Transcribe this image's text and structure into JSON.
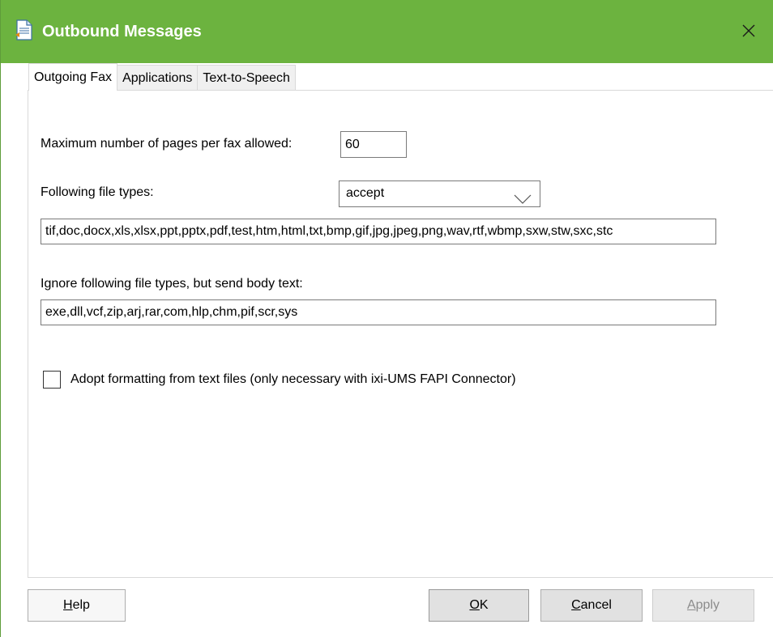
{
  "window": {
    "title": "Outbound Messages",
    "title_bar_color": "#6cb33f"
  },
  "tabs": [
    {
      "label": "Outgoing Fax",
      "active": true
    },
    {
      "label": "Applications",
      "active": false
    },
    {
      "label": "Text-to-Speech",
      "active": false
    }
  ],
  "fax": {
    "max_pages_label": "Maximum number of pages per fax allowed:",
    "max_pages_value": "60",
    "file_types_label": "Following file types:",
    "file_types_mode": "accept",
    "file_types_value": "tif,doc,docx,xls,xlsx,ppt,pptx,pdf,test,htm,html,txt,bmp,gif,jpg,jpeg,png,wav,rtf,wbmp,sxw,stw,sxc,stc",
    "ignore_label": "Ignore following file types, but send body text:",
    "ignore_value": "exe,dll,vcf,zip,arj,rar,com,hlp,chm,pif,scr,sys",
    "adopt_formatting_label": "Adopt formatting from text files (only necessary with ixi-UMS FAPI Connector)",
    "adopt_formatting_checked": false
  },
  "buttons": {
    "help_accel": "H",
    "help_rest": "elp",
    "ok_accel": "O",
    "ok_rest": "K",
    "cancel_accel": "C",
    "cancel_rest": "ancel",
    "apply_accel": "A",
    "apply_rest": "pply"
  },
  "icons": {
    "title": "document-icon",
    "close": "close-icon",
    "dropdown": "chevron-down-icon"
  }
}
